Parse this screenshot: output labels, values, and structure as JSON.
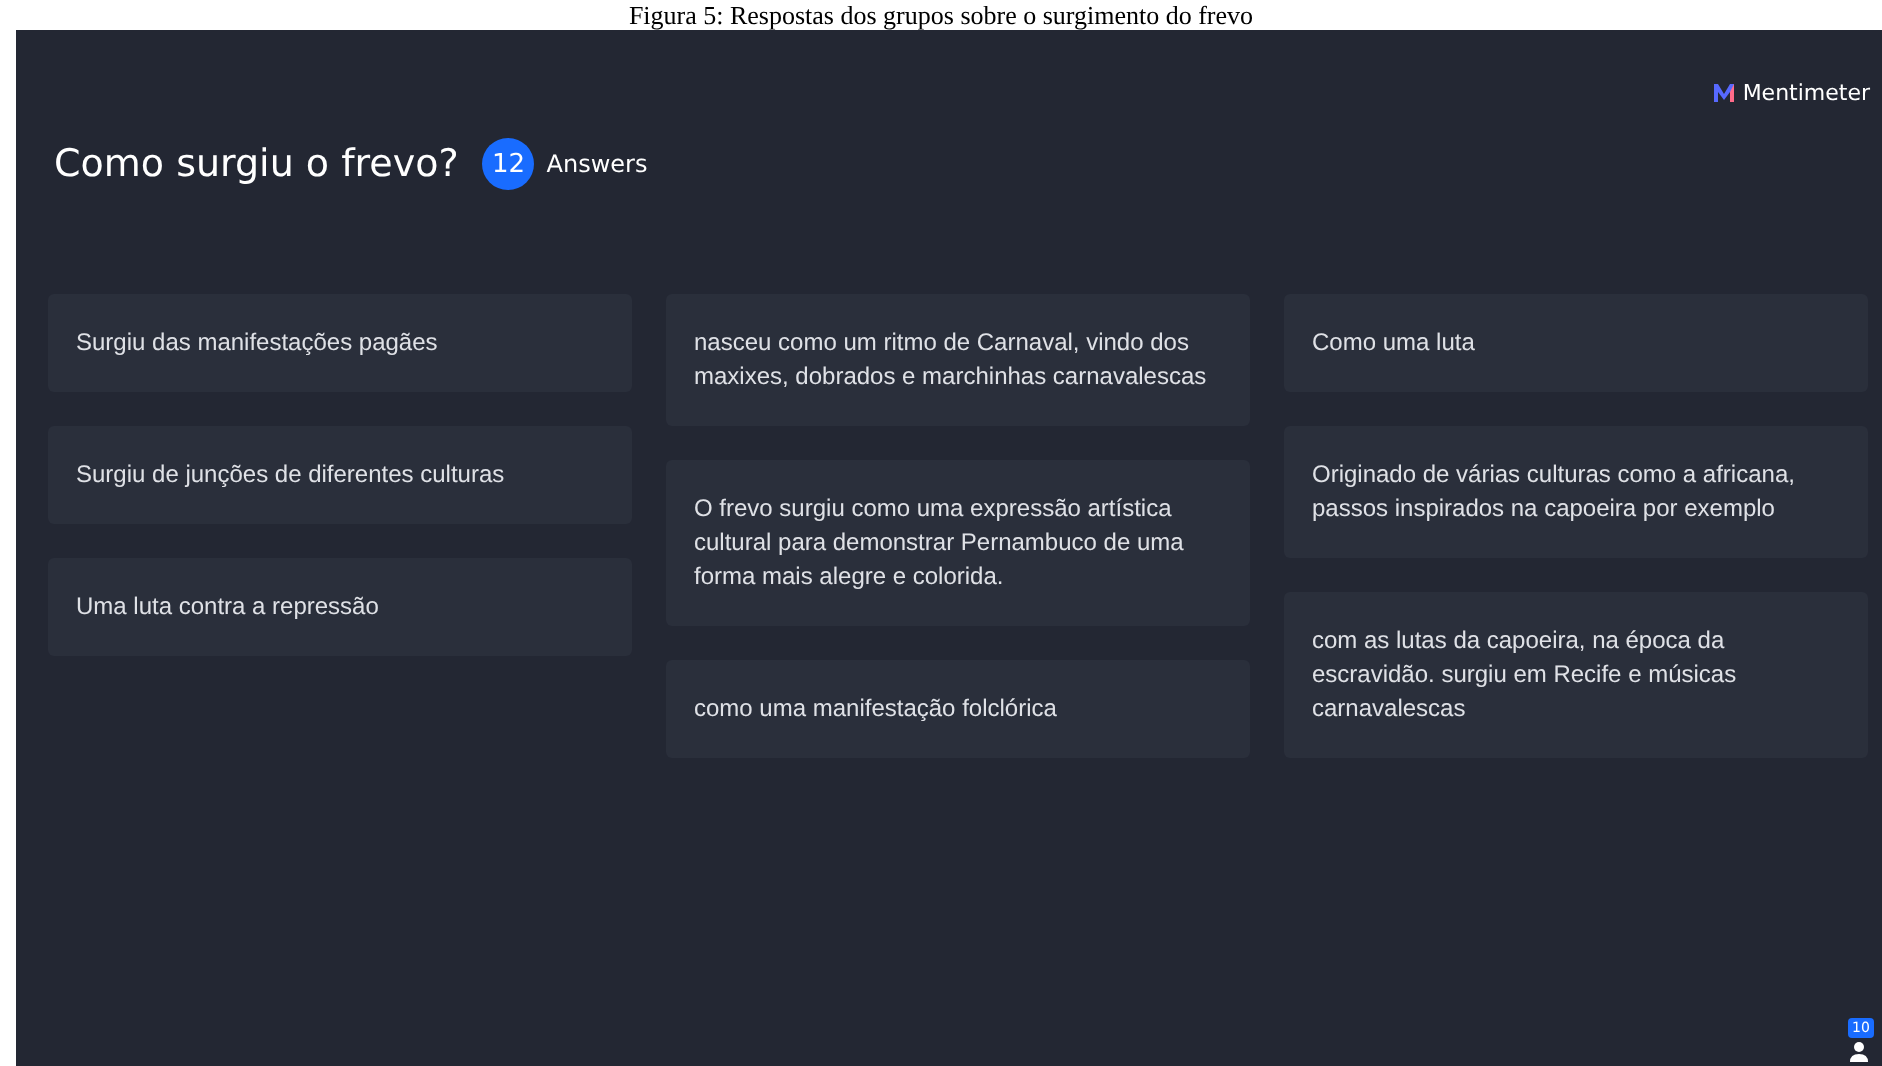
{
  "caption": "Figura 5: Respostas dos grupos sobre o surgimento do frevo",
  "brand": "Mentimeter",
  "question": "Como surgiu o frevo?",
  "answer_count": "12",
  "answer_label": "Answers",
  "columns": [
    [
      "Surgiu das manifestações pagães",
      "Surgiu de junções de diferentes culturas",
      "Uma luta contra a repressão"
    ],
    [
      "nasceu como um ritmo de Carnaval, vindo dos maxixes, dobrados e marchinhas carnavalescas",
      "O frevo surgiu como uma expressão artística cultural para demonstrar Pernambuco de uma forma mais alegre e colorida.",
      "como uma manifestação folclórica"
    ],
    [
      "Como uma luta",
      "Originado de várias culturas como a africana, passos inspirados na capoeira por exemplo",
      "com as lutas da capoeira, na época da escravidão. surgiu em Recife e músicas carnavalescas"
    ]
  ],
  "participants": "10"
}
